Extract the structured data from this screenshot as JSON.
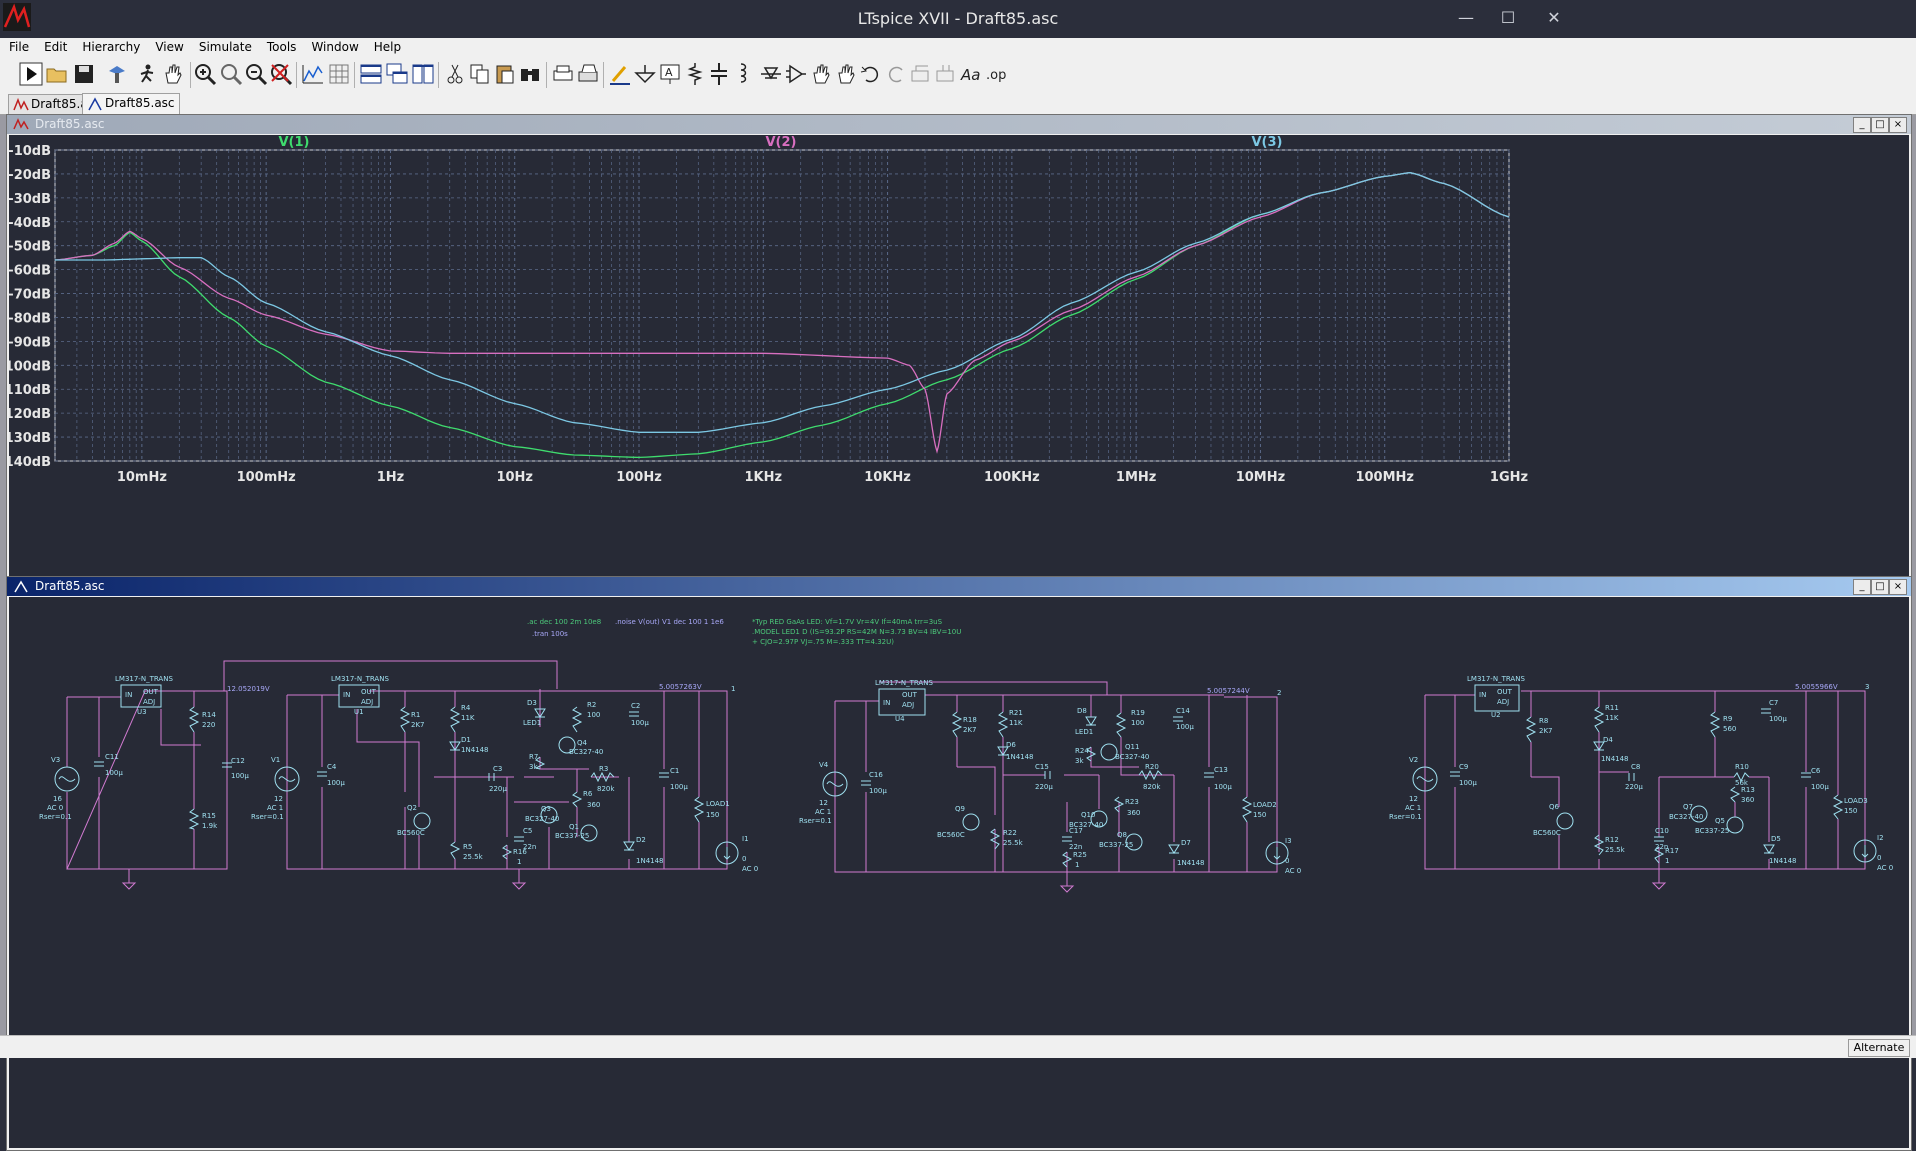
{
  "window": {
    "title": "LTspice XVII - Draft85.asc"
  },
  "menu": [
    "File",
    "Edit",
    "Hierarchy",
    "View",
    "Simulate",
    "Tools",
    "Window",
    "Help"
  ],
  "tabs": [
    {
      "label": "Draft85.asc",
      "kind": "waveform"
    },
    {
      "label": "Draft85.asc",
      "kind": "schematic"
    }
  ],
  "plot_window": {
    "title": "Draft85.asc"
  },
  "schematic_window": {
    "title": "Draft85.asc"
  },
  "chart_data": {
    "type": "line",
    "xscale": "log",
    "xlim": [
      0.002,
      1000000000
    ],
    "ylim": [
      -140,
      -10
    ],
    "grid": true,
    "x_ticks": [
      "10mHz",
      "100mHz",
      "1Hz",
      "10Hz",
      "100Hz",
      "1KHz",
      "10KHz",
      "100KHz",
      "1MHz",
      "10MHz",
      "100MHz",
      "1GHz"
    ],
    "x_tick_values": [
      0.01,
      0.1,
      1,
      10,
      100,
      1000,
      10000,
      100000,
      1000000,
      10000000,
      100000000,
      1000000000
    ],
    "y_ticks": [
      "-10dB",
      "-20dB",
      "-30dB",
      "-40dB",
      "-50dB",
      "-60dB",
      "-70dB",
      "-80dB",
      "-90dB",
      "-100dB",
      "-110dB",
      "-120dB",
      "-130dB",
      "-140dB"
    ],
    "y_tick_values": [
      -10,
      -20,
      -30,
      -40,
      -50,
      -60,
      -70,
      -80,
      -90,
      -100,
      -110,
      -120,
      -130,
      -140
    ],
    "series": [
      {
        "name": "V(1)",
        "color": "#3fdc6e",
        "points": [
          [
            0.002,
            -56
          ],
          [
            0.004,
            -54
          ],
          [
            0.006,
            -50
          ],
          [
            0.008,
            -44.5
          ],
          [
            0.01,
            -48
          ],
          [
            0.02,
            -63
          ],
          [
            0.05,
            -80
          ],
          [
            0.1,
            -92
          ],
          [
            0.3,
            -107
          ],
          [
            1,
            -117
          ],
          [
            3,
            -126
          ],
          [
            10,
            -134
          ],
          [
            30,
            -137.5
          ],
          [
            100,
            -138.5
          ],
          [
            300,
            -137
          ],
          [
            1000,
            -132
          ],
          [
            3000,
            -125
          ],
          [
            10000,
            -116
          ],
          [
            30000,
            -106
          ],
          [
            100000,
            -93
          ],
          [
            300000,
            -79
          ],
          [
            1000000,
            -64
          ],
          [
            3000000,
            -50
          ],
          [
            10000000,
            -37
          ],
          [
            30000000,
            -28
          ],
          [
            100000000,
            -21
          ],
          [
            160000000,
            -19.5
          ],
          [
            300000000,
            -24
          ],
          [
            1000000000,
            -38
          ]
        ]
      },
      {
        "name": "V(2)",
        "color": "#d86fc0",
        "points": [
          [
            0.002,
            -56
          ],
          [
            0.004,
            -54
          ],
          [
            0.006,
            -49
          ],
          [
            0.008,
            -44
          ],
          [
            0.01,
            -47
          ],
          [
            0.02,
            -59
          ],
          [
            0.05,
            -72
          ],
          [
            0.1,
            -79
          ],
          [
            0.3,
            -87
          ],
          [
            1,
            -94
          ],
          [
            3,
            -95
          ],
          [
            10,
            -95
          ],
          [
            100,
            -95
          ],
          [
            1000,
            -95
          ],
          [
            10000,
            -97
          ],
          [
            15000,
            -100
          ],
          [
            20000,
            -110
          ],
          [
            25000,
            -136
          ],
          [
            30000,
            -112
          ],
          [
            50000,
            -98
          ],
          [
            100000,
            -90
          ],
          [
            300000,
            -77
          ],
          [
            1000000,
            -63
          ],
          [
            3000000,
            -50
          ],
          [
            10000000,
            -38
          ],
          [
            30000000,
            -28
          ],
          [
            100000000,
            -21
          ],
          [
            160000000,
            -19.5
          ],
          [
            300000000,
            -24
          ],
          [
            1000000000,
            -38
          ]
        ]
      },
      {
        "name": "V(3)",
        "color": "#7cc8e4",
        "points": [
          [
            0.002,
            -56
          ],
          [
            0.005,
            -56
          ],
          [
            0.01,
            -55.5
          ],
          [
            0.02,
            -55
          ],
          [
            0.03,
            -55
          ],
          [
            0.05,
            -63
          ],
          [
            0.1,
            -74
          ],
          [
            0.3,
            -86
          ],
          [
            1,
            -96
          ],
          [
            3,
            -106
          ],
          [
            10,
            -116
          ],
          [
            30,
            -124
          ],
          [
            100,
            -128
          ],
          [
            300,
            -128
          ],
          [
            1000,
            -124
          ],
          [
            3000,
            -117
          ],
          [
            10000,
            -110
          ],
          [
            30000,
            -102
          ],
          [
            100000,
            -89
          ],
          [
            300000,
            -74
          ],
          [
            1000000,
            -61
          ],
          [
            3000000,
            -49
          ],
          [
            10000000,
            -37
          ],
          [
            30000000,
            -28
          ],
          [
            100000000,
            -21
          ],
          [
            160000000,
            -19.5
          ],
          [
            300000000,
            -24
          ],
          [
            1000000000,
            -38
          ]
        ]
      }
    ]
  },
  "schematic": {
    "directives": [
      ".ac dec 100 2m 10e8",
      ".tran 100s",
      ".noise V(out) V1 dec 100 1 1e6"
    ],
    "model_lines": [
      "*Typ RED GaAs LED: Vf=1.7V Vr=4V If=40mA trr=3uS",
      ".MODEL LED1 D (IS=93.2P RS=42M N=3.73 BV=4 IBV=10U",
      "+ CJO=2.97P VJ=.75 M=.333 TT=4.32U)"
    ],
    "labels": {
      "lm317": "LM317-N_TRANS",
      "pin_in": "IN",
      "pin_out": "OUT",
      "pin_adj": "ADJ",
      "u1": "U1",
      "u2": "U2",
      "u3": "U3",
      "u4": "U4",
      "v_node3": "12.052019V",
      "v_node1": "5.0057263V",
      "v_node2": "5.0057244V",
      "v_node4": "5.0055966V",
      "v3": "V3",
      "v3_val": "16",
      "v3_ac": "AC 0",
      "v3_r": "Rser=0.1",
      "v1": "V1",
      "v1_val": "12",
      "v1_ac": "AC 1",
      "v1_r": "Rser=0.1",
      "v4": "V4",
      "v4_val": "12",
      "v4_ac": "AC 1",
      "v4_r": "Rser=0.1",
      "v2": "V2",
      "v2_val": "12",
      "v2_ac": "AC 1",
      "v2_r": "Rser=0.1",
      "c11": "C11",
      "c11v": "100µ",
      "r14": "R14",
      "r14v": "220",
      "r15": "R15",
      "r15v": "1.9k",
      "c12": "C12",
      "c12v": "100µ",
      "c4": "C4",
      "c4v": "100µ",
      "r1": "R1",
      "r1v": "2K7",
      "r4": "R4",
      "r4v": "11K",
      "d1": "D1",
      "d1v": "1N4148",
      "d3": "D3",
      "d3v": "LED1",
      "r2": "R2",
      "r2v": "100",
      "q4": "Q4",
      "q4v": "BC327-40",
      "r7": "R7",
      "r7v": "3k",
      "c2": "C2",
      "c2v": "100µ",
      "c3": "C3",
      "c3v": "220µ",
      "r3": "R3",
      "r3v": "820k",
      "r6": "R6",
      "r6v": "360",
      "q3": "Q3",
      "q3v": "BC327-40",
      "q1": "Q1",
      "q1v": "BC337-25",
      "c5": "C5",
      "c5v": "22n",
      "r16": "R16",
      "r16v": "1",
      "q2": "Q2",
      "q2v": "BC560C",
      "r5": "R5",
      "r5v": "25.5k",
      "d2": "D2",
      "d2v": "1N4148",
      "c1": "C1",
      "c1v": "100µ",
      "load1": "LOAD1",
      "load1v": "150",
      "i1": "I1",
      "i1v": "0",
      "i1ac": "AC 0",
      "n1": "1",
      "n2": "2",
      "n3": "3",
      "c16": "C16",
      "c16v": "100µ",
      "r18": "R18",
      "r18v": "2K7",
      "r21": "R21",
      "r21v": "11K",
      "d6": "D6",
      "d6v": "1N4148",
      "d8": "D8",
      "d8v": "LED1",
      "r19": "R19",
      "r19v": "100",
      "q11": "Q11",
      "q11v": "BC327-40",
      "r24": "R24",
      "r24v": "3k",
      "c14": "C14",
      "c14v": "100µ",
      "c15": "C15",
      "c15v": "220µ",
      "r20": "R20",
      "r20v": "820k",
      "r23": "R23",
      "r23v": "360",
      "q10": "Q10",
      "q10v": "BC327-40",
      "q8": "Q8",
      "q8v": "BC337-25",
      "c17": "C17",
      "c17v": "22n",
      "r25": "R25",
      "r25v": "1",
      "q9": "Q9",
      "q9v": "BC560C",
      "r22": "R22",
      "r22v": "25.5k",
      "d7": "D7",
      "d7v": "1N4148",
      "c13": "C13",
      "c13v": "100µ",
      "load2": "LOAD2",
      "load2v": "150",
      "i3": "I3",
      "i3v": "0",
      "i3ac": "AC 0",
      "c9": "C9",
      "c9v": "100µ",
      "r8": "R8",
      "r8v": "2K7",
      "r11": "R11",
      "r11v": "11K",
      "d4": "D4",
      "d4v": "1N4148",
      "r9": "R9",
      "r9v": "560",
      "c7": "C7",
      "c7v": "100µ",
      "c8": "C8",
      "c8v": "220µ",
      "r10": "R10",
      "r10v": "56k",
      "r13": "R13",
      "r13v": "360",
      "q7": "Q7",
      "q7v": "BC327-40",
      "q5": "Q5",
      "q5v": "BC337-25",
      "c10": "C10",
      "c10v": "22n",
      "r17": "R17",
      "r17v": "1",
      "q6": "Q6",
      "q6v": "BC560C",
      "r12": "R12",
      "r12v": "25.5k",
      "d5": "D5",
      "d5v": "1N4148",
      "c6": "C6",
      "c6v": "100µ",
      "load3": "LOAD3",
      "load3v": "150",
      "i2": "I2",
      "i2v": "0",
      "i2ac": "AC 0"
    }
  },
  "status": {
    "mode": "Alternate"
  },
  "toolbar_icons": [
    "run-icon",
    "open-icon",
    "save-icon",
    "control-panel-icon",
    "halt-icon",
    "pan-hand-icon",
    "zoom-in-icon",
    "zoom-area-icon",
    "zoom-out-icon",
    "zoom-fit-icon",
    "autorange-icon",
    "grid-icon",
    "tile-horizontal-icon",
    "cascade-icon",
    "tile-vertical-icon",
    "cut-icon",
    "copy-icon",
    "paste-icon",
    "find-icon",
    "print-setup-icon",
    "print-icon",
    "draw-wire-icon",
    "ground-icon",
    "label-net-icon",
    "resistor-icon",
    "capacitor-icon",
    "inductor-icon",
    "diode-icon",
    "component-icon",
    "move-icon",
    "drag-icon",
    "undo-icon",
    "redo-icon",
    "rotate-icon",
    "mirror-icon",
    "text-icon",
    "spice-directive-icon"
  ],
  "colors": {
    "background": "#272a36",
    "grid": "#5b6a8a",
    "wire": "#d07ad0",
    "component": "#9fe0f0",
    "label": "#a8a8f8",
    "directive": "#4cc87a"
  }
}
